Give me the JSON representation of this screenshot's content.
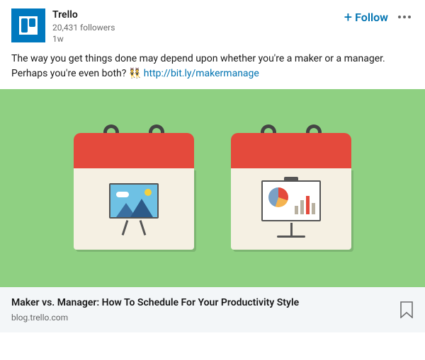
{
  "header": {
    "name": "Trello",
    "followers": "20,431 followers",
    "time": "1w",
    "follow_label": "Follow"
  },
  "post": {
    "text": "The way you get things done may depend upon whether you're a maker or a manager. Perhaps you're even both? ",
    "emoji": "👯",
    "link_text": "http://bit.ly/makermanage"
  },
  "card": {
    "title": "Maker vs. Manager: How To Schedule For Your Productivity Style",
    "domain": "blog.trello.com"
  }
}
